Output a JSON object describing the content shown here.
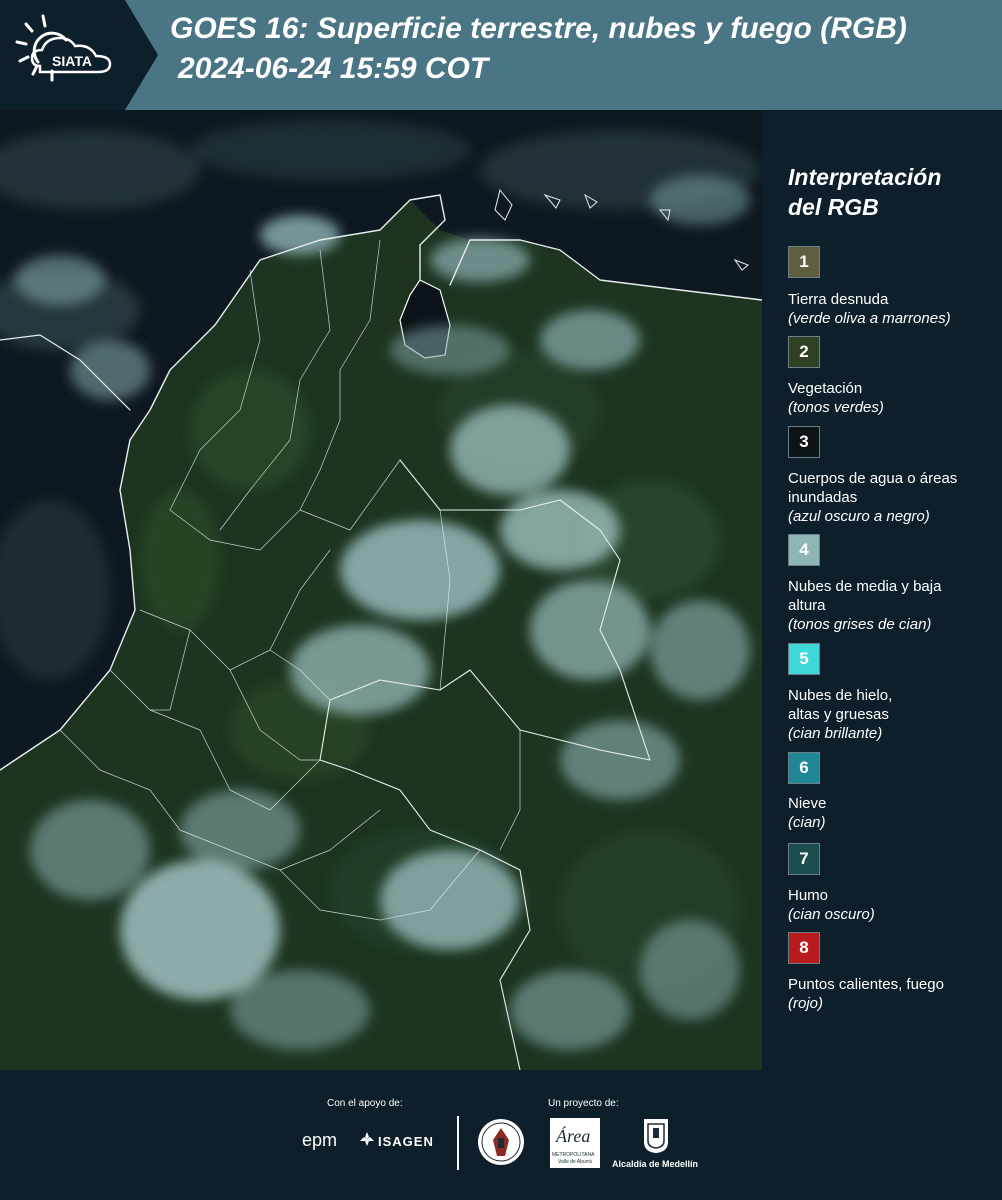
{
  "header": {
    "logo_text": "SIATA",
    "title_line1": "GOES 16: Superficie terrestre, nubes y fuego (RGB)",
    "title_line2": "2024-06-24 15:59 COT"
  },
  "legend": {
    "title_line1": "Interpretación",
    "title_line2": "del RGB",
    "items": [
      {
        "number": "1",
        "label": "Tierra desnuda",
        "sublabel": "(verde oliva a marrones)",
        "color": "#5f5e41"
      },
      {
        "number": "2",
        "label": "Vegetación",
        "sublabel": "(tonos verdes)",
        "color": "#2e4123"
      },
      {
        "number": "3",
        "label": "Cuerpos de agua o áreas inundadas",
        "sublabel": "(azul oscuro a negro)",
        "color": "#0c1418"
      },
      {
        "number": "4",
        "label": "Nubes de media y baja altura",
        "sublabel": "(tonos grises de cian)",
        "color": "#8fb5b5"
      },
      {
        "number": "5",
        "label": "Nubes de hielo, altas y gruesas",
        "sublabel": "(cian brillante)",
        "color": "#3fd8d8"
      },
      {
        "number": "6",
        "label": "Nieve",
        "sublabel": "(cian)",
        "color": "#208696"
      },
      {
        "number": "7",
        "label": "Humo",
        "sublabel": "(cian oscuro)",
        "color": "#1c4d4f"
      },
      {
        "number": "8",
        "label": "Puntos calientes, fuego",
        "sublabel": "(rojo)",
        "color": "#b81b1d"
      }
    ]
  },
  "footer": {
    "support_caption": "Con el apoyo de:",
    "project_caption": "Un proyecto de:",
    "epm": "epm",
    "isagen": "ISAGEN",
    "area_name": "Área",
    "area_sub": "METROPOLITANA",
    "area_sub2": "Valle de Aburrá",
    "alcaldia": "Alcaldía de Medellín"
  },
  "colors": {
    "header_bg": "#4a7584",
    "page_bg": "#0d1f2a",
    "land": "#1c3320",
    "ocean": "#0e1820",
    "cloud": "#9ec3c4"
  }
}
